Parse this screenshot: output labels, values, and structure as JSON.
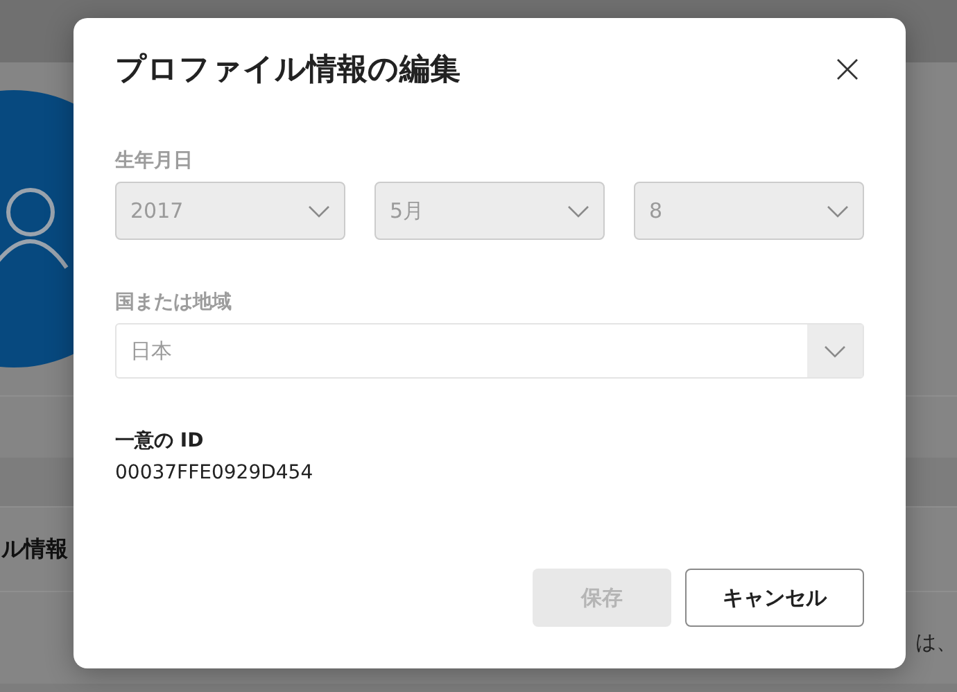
{
  "background": {
    "section_title": "ル情報",
    "section_text": "は、"
  },
  "dialog": {
    "title": "プロファイル情報の編集",
    "birthdate": {
      "label": "生年月日",
      "disabled": true,
      "selects": [
        {
          "value": "2017"
        },
        {
          "value": "5月"
        },
        {
          "value": "8"
        }
      ]
    },
    "region": {
      "label": "国または地域",
      "value": "日本",
      "disabled": true
    },
    "unique_id": {
      "label": "一意の ID",
      "value": "00037FFE0929D454"
    },
    "buttons": [
      {
        "label": "保存",
        "kind": "primary",
        "disabled": true
      },
      {
        "label": "キャンセル",
        "kind": "secondary",
        "disabled": false
      }
    ]
  }
}
